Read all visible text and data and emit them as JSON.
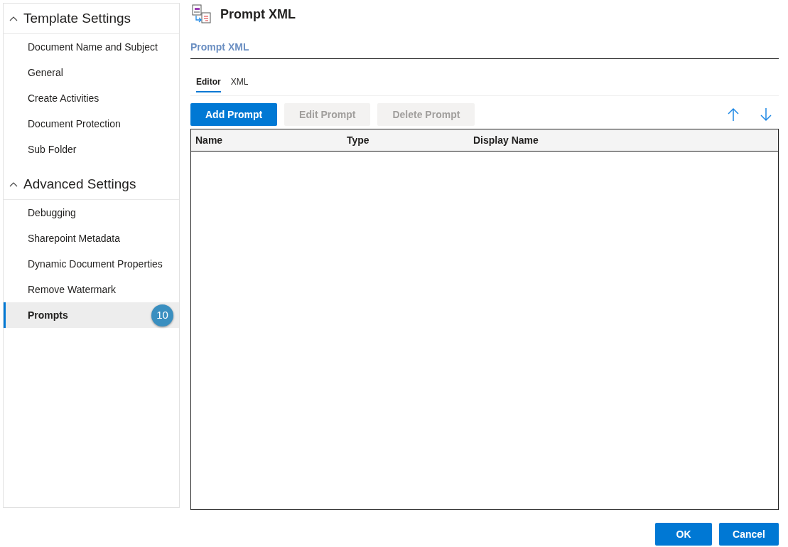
{
  "sidebar": {
    "sections": [
      {
        "title": "Template Settings",
        "expanded": true,
        "items": [
          {
            "label": "Document Name and Subject",
            "selected": false
          },
          {
            "label": "General",
            "selected": false
          },
          {
            "label": "Create Activities",
            "selected": false
          },
          {
            "label": "Document Protection",
            "selected": false
          },
          {
            "label": "Sub Folder",
            "selected": false
          }
        ]
      },
      {
        "title": "Advanced Settings",
        "expanded": true,
        "items": [
          {
            "label": "Debugging",
            "selected": false
          },
          {
            "label": "Sharepoint Metadata",
            "selected": false
          },
          {
            "label": "Dynamic Document Properties",
            "selected": false
          },
          {
            "label": "Remove Watermark",
            "selected": false
          },
          {
            "label": "Prompts",
            "selected": true,
            "badge": "10"
          }
        ]
      }
    ]
  },
  "page": {
    "title": "Prompt XML",
    "field_label": "Prompt XML",
    "tabs": [
      {
        "label": "Editor",
        "selected": true
      },
      {
        "label": "XML",
        "selected": false
      }
    ],
    "toolbar": [
      {
        "label": "Add Prompt",
        "disabled": false
      },
      {
        "label": "Edit Prompt",
        "disabled": true
      },
      {
        "label": "Delete Prompt",
        "disabled": true
      }
    ],
    "table": {
      "columns": [
        "Name",
        "Type",
        "Display Name"
      ]
    }
  },
  "footer": {
    "buttons": [
      "OK",
      "Cancel"
    ]
  }
}
